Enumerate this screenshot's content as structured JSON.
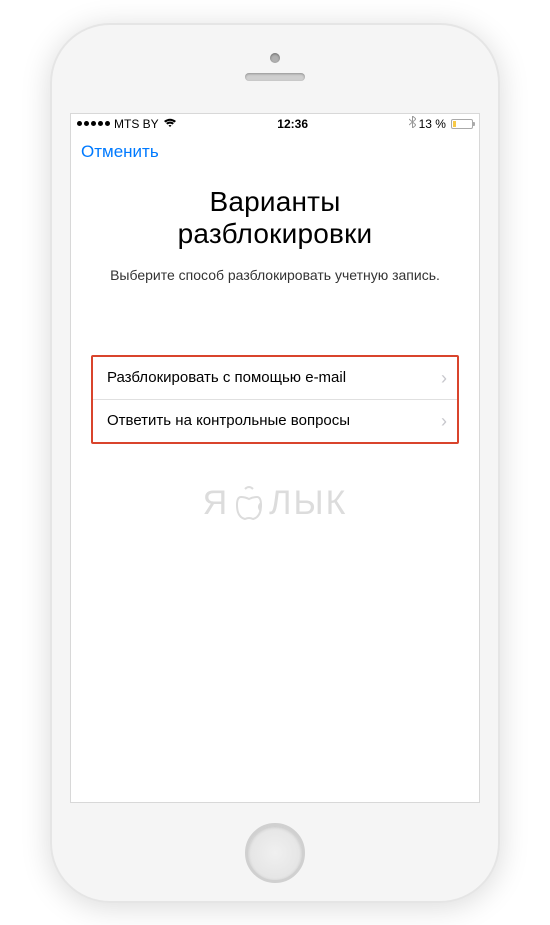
{
  "status_bar": {
    "carrier": "MTS BY",
    "time": "12:36",
    "battery_percent": "13 %"
  },
  "nav": {
    "cancel": "Отменить"
  },
  "heading": {
    "line1": "Варианты",
    "line2": "разблокировки"
  },
  "subtitle": "Выберите способ разблокировать учетную запись.",
  "options": [
    {
      "label": "Разблокировать с помощью e-mail"
    },
    {
      "label": "Ответить на контрольные вопросы"
    }
  ],
  "watermark": {
    "left": "Я",
    "right": "ЛЫК"
  }
}
